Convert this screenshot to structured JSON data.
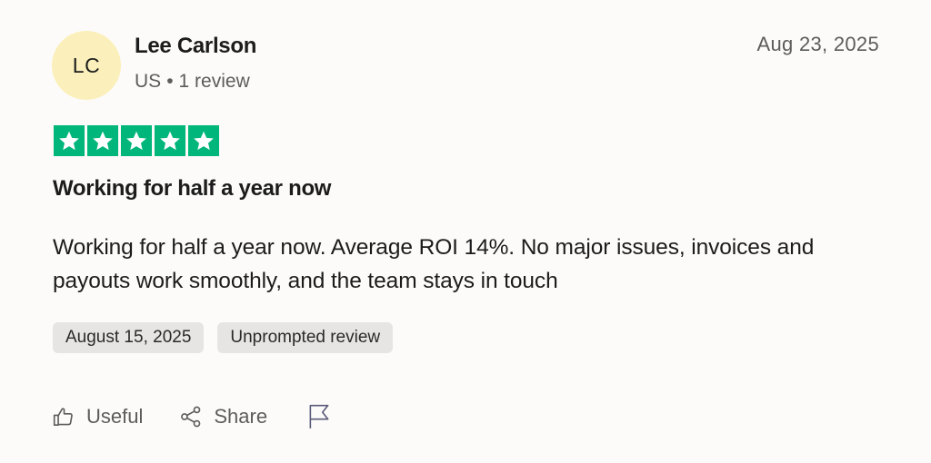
{
  "author": {
    "initials": "LC",
    "name": "Lee Carlson",
    "country": "US",
    "separator": "•",
    "review_count": "1 review"
  },
  "review": {
    "date_top": "Aug 23, 2025",
    "rating": 5,
    "rating_max": 5,
    "star_color": "#00b67a",
    "title": "Working for half a year now",
    "body": "Working for half a year now. Average ROI 14%. No major issues, invoices and payouts work smoothly, and the team stays in touch",
    "tags": [
      "August 15, 2025",
      "Unprompted review"
    ]
  },
  "actions": {
    "useful_label": "Useful",
    "share_label": "Share",
    "icons": {
      "useful": "thumbs-up-icon",
      "share": "share-icon",
      "report": "flag-icon"
    }
  }
}
